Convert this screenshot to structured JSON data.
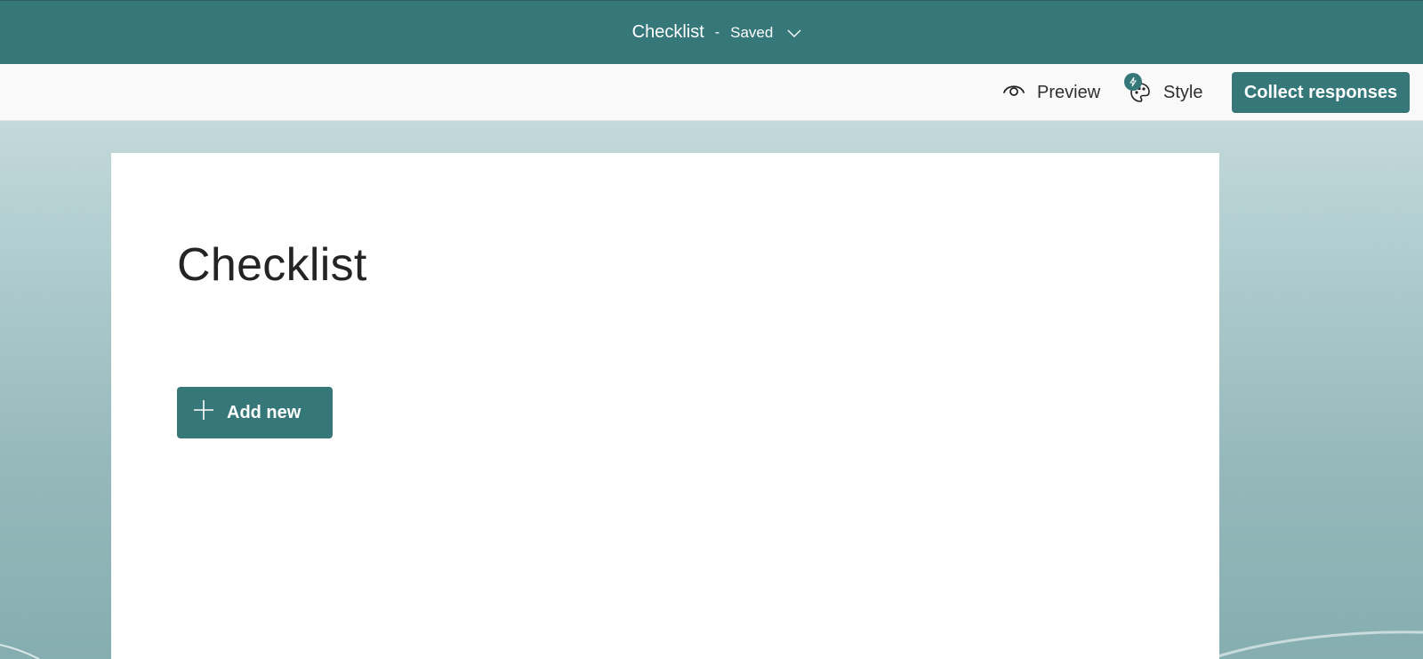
{
  "header": {
    "title": "Checklist",
    "separator": "-",
    "status": "Saved"
  },
  "toolbar": {
    "preview_label": "Preview",
    "style_label": "Style",
    "collect_label": "Collect responses"
  },
  "form": {
    "title": "Checklist",
    "add_new_label": "Add new"
  },
  "colors": {
    "accent": "#367779",
    "toolbar_bg": "#f9f9f9",
    "card_bg": "#ffffff",
    "text": "#242424"
  },
  "icons": {
    "chevron": "chevron-down-icon",
    "preview": "eye-icon",
    "style": "palette-icon",
    "style_badge": "lightning-icon",
    "add": "plus-icon"
  }
}
